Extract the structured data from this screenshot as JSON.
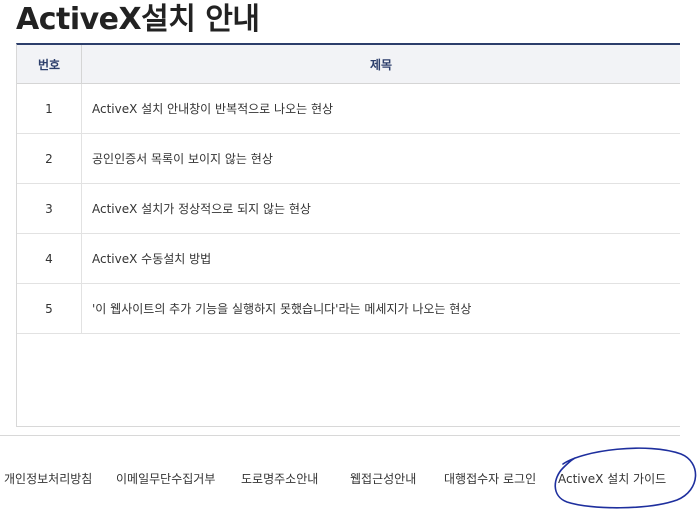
{
  "page": {
    "title": "ActiveX설치 안내"
  },
  "table": {
    "headers": {
      "number": "번호",
      "subject": "제목"
    },
    "rows": [
      {
        "number": "1",
        "subject": "ActiveX 설치 안내창이 반복적으로 나오는 현상"
      },
      {
        "number": "2",
        "subject": "공인인증서 목록이 보이지 않는 현상"
      },
      {
        "number": "3",
        "subject": "ActiveX 설치가 정상적으로 되지 않는 현상"
      },
      {
        "number": "4",
        "subject": "ActiveX 수동설치 방법"
      },
      {
        "number": "5",
        "subject": "'이 웹사이트의 추가 기능을 실행하지 못했습니다'라는 메세지가 나오는 현상"
      }
    ]
  },
  "footer": {
    "links": [
      "개인정보처리방침",
      "이메일무단수집거부",
      "도로명주소안내",
      "웹접근성안내",
      "대행접수자 로그인",
      "ActiveX 설치 가이드"
    ]
  },
  "colors": {
    "header_text": "#2c3e6b",
    "annotation_circle": "#1e2f9e"
  }
}
